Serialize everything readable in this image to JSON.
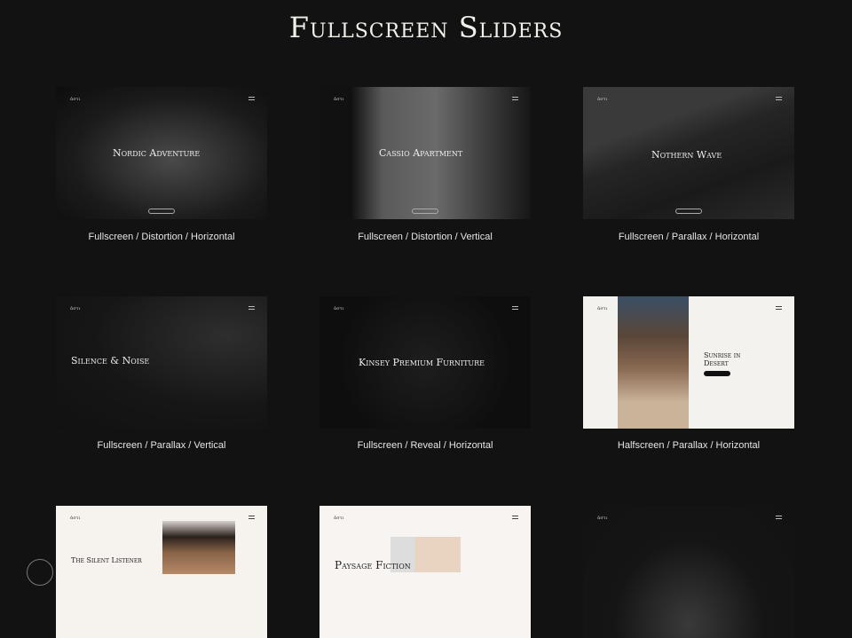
{
  "title": "Fullscreen Sliders",
  "cards": [
    {
      "title": "Nordic Adventure",
      "caption": "Fullscreen / Distortion / Horizontal",
      "logo": "ἀστι"
    },
    {
      "title": "Cassio Apartment",
      "caption": "Fullscreen / Distortion / Vertical",
      "logo": "ἀστι"
    },
    {
      "title": "Nothern Wave",
      "caption": "Fullscreen / Parallax / Horizontal",
      "logo": "ἀστι"
    },
    {
      "title": "Silence & Noise",
      "caption": "Fullscreen / Parallax / Vertical",
      "logo": "ἀστι"
    },
    {
      "title": "Kinsey Premium Furniture",
      "caption": "Fullscreen / Reveal / Horizontal",
      "logo": "ἀστι"
    },
    {
      "title": "Sunrise in Desert",
      "caption": "Halfscreen / Parallax / Horizontal",
      "logo": "ἀστι"
    },
    {
      "title": "The Silent Listener",
      "caption": "",
      "logo": "ἀστι"
    },
    {
      "title": "Paysage Fiction",
      "caption": "",
      "logo": "ἀστι"
    },
    {
      "title": "",
      "caption": "",
      "logo": "ἀστι"
    }
  ]
}
